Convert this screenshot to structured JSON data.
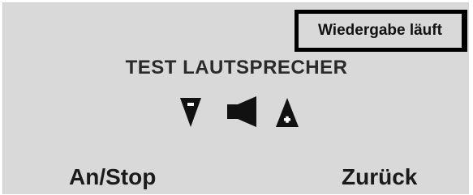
{
  "status": {
    "text": "Wiedergabe läuft"
  },
  "screen": {
    "title": "TEST LAUTSPRECHER"
  },
  "controls": {
    "volume_down_icon": "triangle-down-minus-icon",
    "speaker_icon": "speaker-icon",
    "volume_up_icon": "triangle-up-plus-icon"
  },
  "softkeys": {
    "left_label": "An/Stop",
    "right_label": "Zurück"
  },
  "colors": {
    "background": "#d9d9d9",
    "foreground": "#1b1b1b",
    "border": "#000000"
  }
}
